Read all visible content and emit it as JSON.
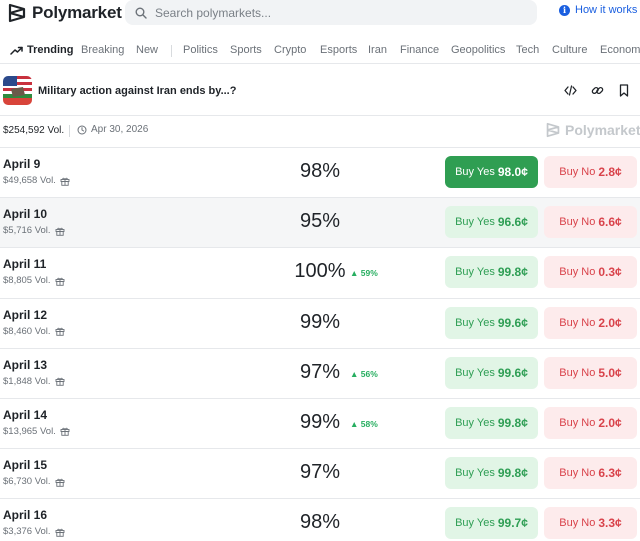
{
  "header": {
    "brand": "Polymarket",
    "search_placeholder": "Search polymarkets...",
    "how_it_works": "How it works",
    "accent_color": "#1a5fe0"
  },
  "nav": {
    "trending": "Trending",
    "items": [
      "Breaking",
      "New",
      "Politics",
      "Sports",
      "Crypto",
      "Esports",
      "Iran",
      "Finance",
      "Geopolitics",
      "Tech",
      "Culture",
      "Economy"
    ]
  },
  "market": {
    "title": "Military action against Iran ends by...?",
    "volume": "$254,592 Vol.",
    "end_date": "Apr 30, 2026",
    "watermark": "Polymarket",
    "icons": [
      "embed-icon",
      "link-icon",
      "bookmark-icon"
    ]
  },
  "labels": {
    "buy_yes": "Buy Yes",
    "buy_no": "Buy No"
  },
  "colors": {
    "yes_green": "#2f9e52",
    "no_red": "#d9434b",
    "delta_green": "#27ae60"
  },
  "outcomes": [
    {
      "date": "April 9",
      "vol": "$49,658 Vol.",
      "pct": "98%",
      "delta": "",
      "yes": "98.0¢",
      "no": "2.8¢",
      "selected": true
    },
    {
      "date": "April 10",
      "vol": "$5,716 Vol.",
      "pct": "95%",
      "delta": "",
      "yes": "96.6¢",
      "no": "6.6¢"
    },
    {
      "date": "April 11",
      "vol": "$8,805 Vol.",
      "pct": "100%",
      "delta": "59%",
      "yes": "99.8¢",
      "no": "0.3¢"
    },
    {
      "date": "April 12",
      "vol": "$8,460 Vol.",
      "pct": "99%",
      "delta": "",
      "yes": "99.6¢",
      "no": "2.0¢"
    },
    {
      "date": "April 13",
      "vol": "$1,848 Vol.",
      "pct": "97%",
      "delta": "56%",
      "yes": "99.6¢",
      "no": "5.0¢"
    },
    {
      "date": "April 14",
      "vol": "$13,965 Vol.",
      "pct": "99%",
      "delta": "58%",
      "yes": "99.8¢",
      "no": "2.0¢"
    },
    {
      "date": "April 15",
      "vol": "$6,730 Vol.",
      "pct": "97%",
      "delta": "",
      "yes": "99.8¢",
      "no": "6.3¢"
    },
    {
      "date": "April 16",
      "vol": "$3,376 Vol.",
      "pct": "98%",
      "delta": "",
      "yes": "99.7¢",
      "no": "3.3¢"
    }
  ]
}
